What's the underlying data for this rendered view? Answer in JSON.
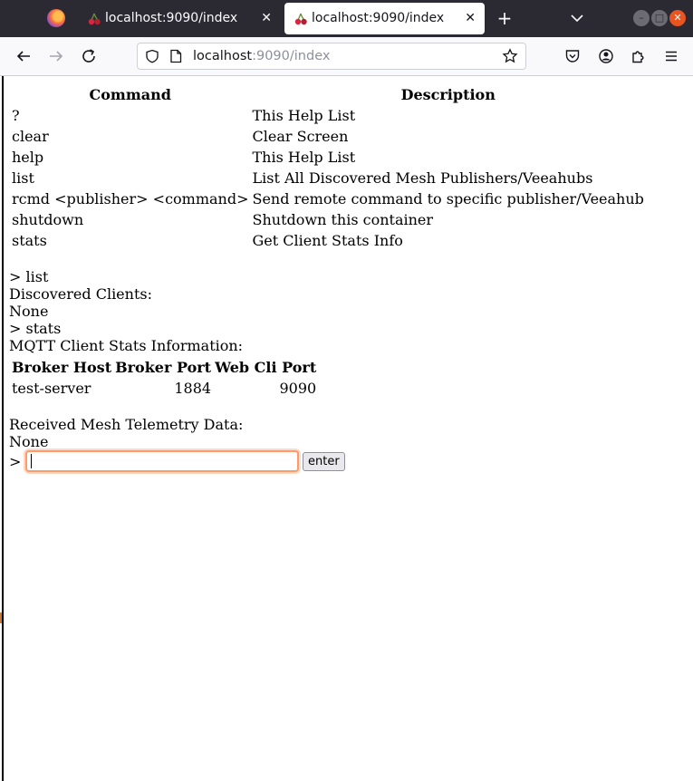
{
  "browser": {
    "tabs": [
      {
        "title": "localhost:9090/index",
        "active": false
      },
      {
        "title": "localhost:9090/index",
        "active": true
      }
    ],
    "tab_close_glyph": "✕",
    "new_tab_glyph": "+",
    "url_host": "localhost",
    "url_rest": ":9090/index",
    "icons": [
      "firefox-logo",
      "back-arrow",
      "forward-arrow",
      "reload",
      "shield",
      "page-info",
      "bookmark-star",
      "pocket",
      "account",
      "extensions",
      "hamburger-menu"
    ],
    "window_controls": {
      "minimize": "–",
      "maximize": "□",
      "close": "✕"
    }
  },
  "help": {
    "header_command": "Command",
    "header_description": "Description",
    "rows": [
      {
        "command": "?",
        "description": "This Help List"
      },
      {
        "command": "clear",
        "description": "Clear Screen"
      },
      {
        "command": "help",
        "description": "This Help List"
      },
      {
        "command": "list",
        "description": "List All Discovered Mesh Publishers/Veeahubs"
      },
      {
        "command": "rcmd <publisher> <command>",
        "description": "Send remote command to specific publisher/Veeahub"
      },
      {
        "command": "shutdown",
        "description": "Shutdown this container"
      },
      {
        "command": "stats",
        "description": "Get Client Stats Info"
      }
    ]
  },
  "console": {
    "list_cmd": "> list",
    "discovered_label": "Discovered Clients:",
    "discovered_value": "None",
    "stats_cmd": "> stats",
    "stats_label": "MQTT Client Stats Information:",
    "stats_headers": [
      "Broker Host",
      "Broker Port",
      "Web Cli Port"
    ],
    "stats_row": [
      "test-server",
      "1884",
      "9090"
    ],
    "telemetry_label": "Received Mesh Telemetry Data:",
    "telemetry_value": "None",
    "prompt": ">",
    "input_value": "",
    "enter_label": "enter"
  },
  "colors": {
    "tabbar": "#2b2a33",
    "focus_ring": "#ff9a6a",
    "close_button": "#e95420"
  }
}
